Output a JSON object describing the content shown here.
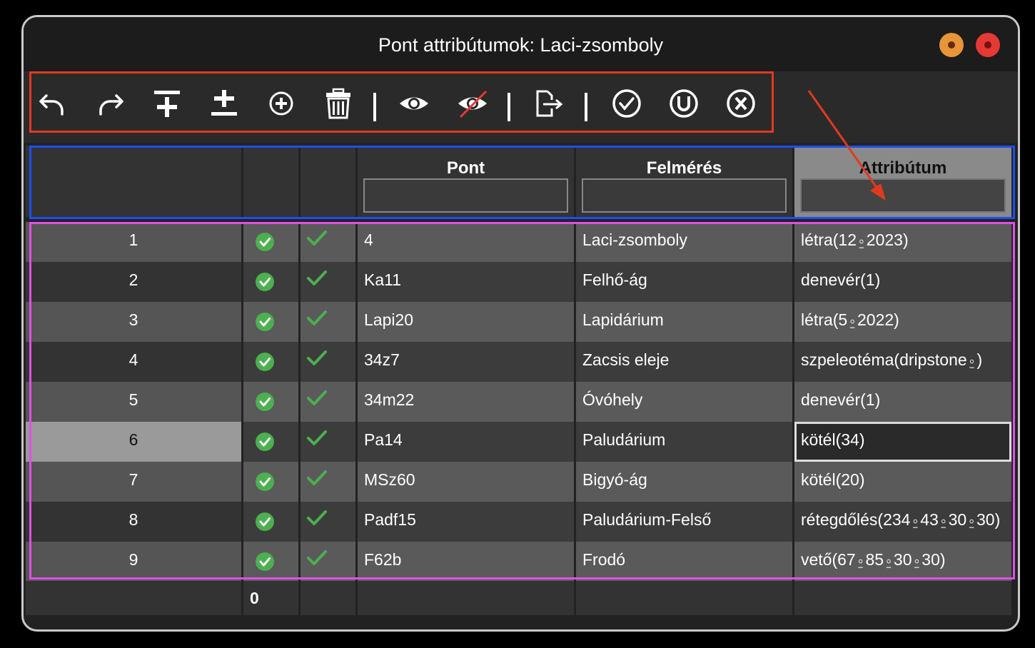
{
  "window": {
    "title": "Pont attribútumok: Laci-zsomboly"
  },
  "toolbar": {
    "buttons": [
      {
        "icon": "undo-icon"
      },
      {
        "icon": "redo-icon"
      },
      {
        "icon": "insert-row-icon"
      },
      {
        "icon": "add-remove-row-icon"
      },
      {
        "icon": "add-circle-icon"
      },
      {
        "icon": "delete-icon"
      },
      {
        "icon": "show-icon"
      },
      {
        "icon": "hide-icon"
      },
      {
        "icon": "export-icon"
      },
      {
        "icon": "check-circle-icon"
      },
      {
        "icon": "u-circle-icon"
      },
      {
        "icon": "x-circle-icon"
      }
    ]
  },
  "columns": {
    "pont": "Pont",
    "felmeres": "Felmérés",
    "attributum": "Attribútum"
  },
  "rows": [
    {
      "num": "1",
      "pont": "4",
      "felmeres": "Laci-zsomboly",
      "attr": "létra(12⍛2023)"
    },
    {
      "num": "2",
      "pont": "Ka11",
      "felmeres": "Felhő-ág",
      "attr": "denevér(1)"
    },
    {
      "num": "3",
      "pont": "Lapi20",
      "felmeres": "Lapidárium",
      "attr": "létra(5⍛2022)"
    },
    {
      "num": "4",
      "pont": "34z7",
      "felmeres": "Zacsis eleje",
      "attr": "szpeleotéma(dripstone⍛)"
    },
    {
      "num": "5",
      "pont": "34m22",
      "felmeres": "Óvóhely",
      "attr": "denevér(1)"
    },
    {
      "num": "6",
      "pont": "Pa14",
      "felmeres": "Paludárium",
      "attr": "kötél(34)"
    },
    {
      "num": "7",
      "pont": "MSz60",
      "felmeres": "Bigyó-ág",
      "attr": "kötél(20)"
    },
    {
      "num": "8",
      "pont": "Padf15",
      "felmeres": "Paludárium-Felső",
      "attr": "rétegdőlés(234⍛43⍛30⍛30)"
    },
    {
      "num": "9",
      "pont": "F62b",
      "felmeres": "Frodó",
      "attr": "vető(67⍛85⍛30⍛30)"
    }
  ],
  "footer": {
    "count": "0"
  },
  "colors": {
    "toolbar_highlight": "#e23a1f",
    "header_highlight": "#1c4ff0",
    "rows_highlight": "#e04fe6",
    "check_green": "#4caf50"
  }
}
